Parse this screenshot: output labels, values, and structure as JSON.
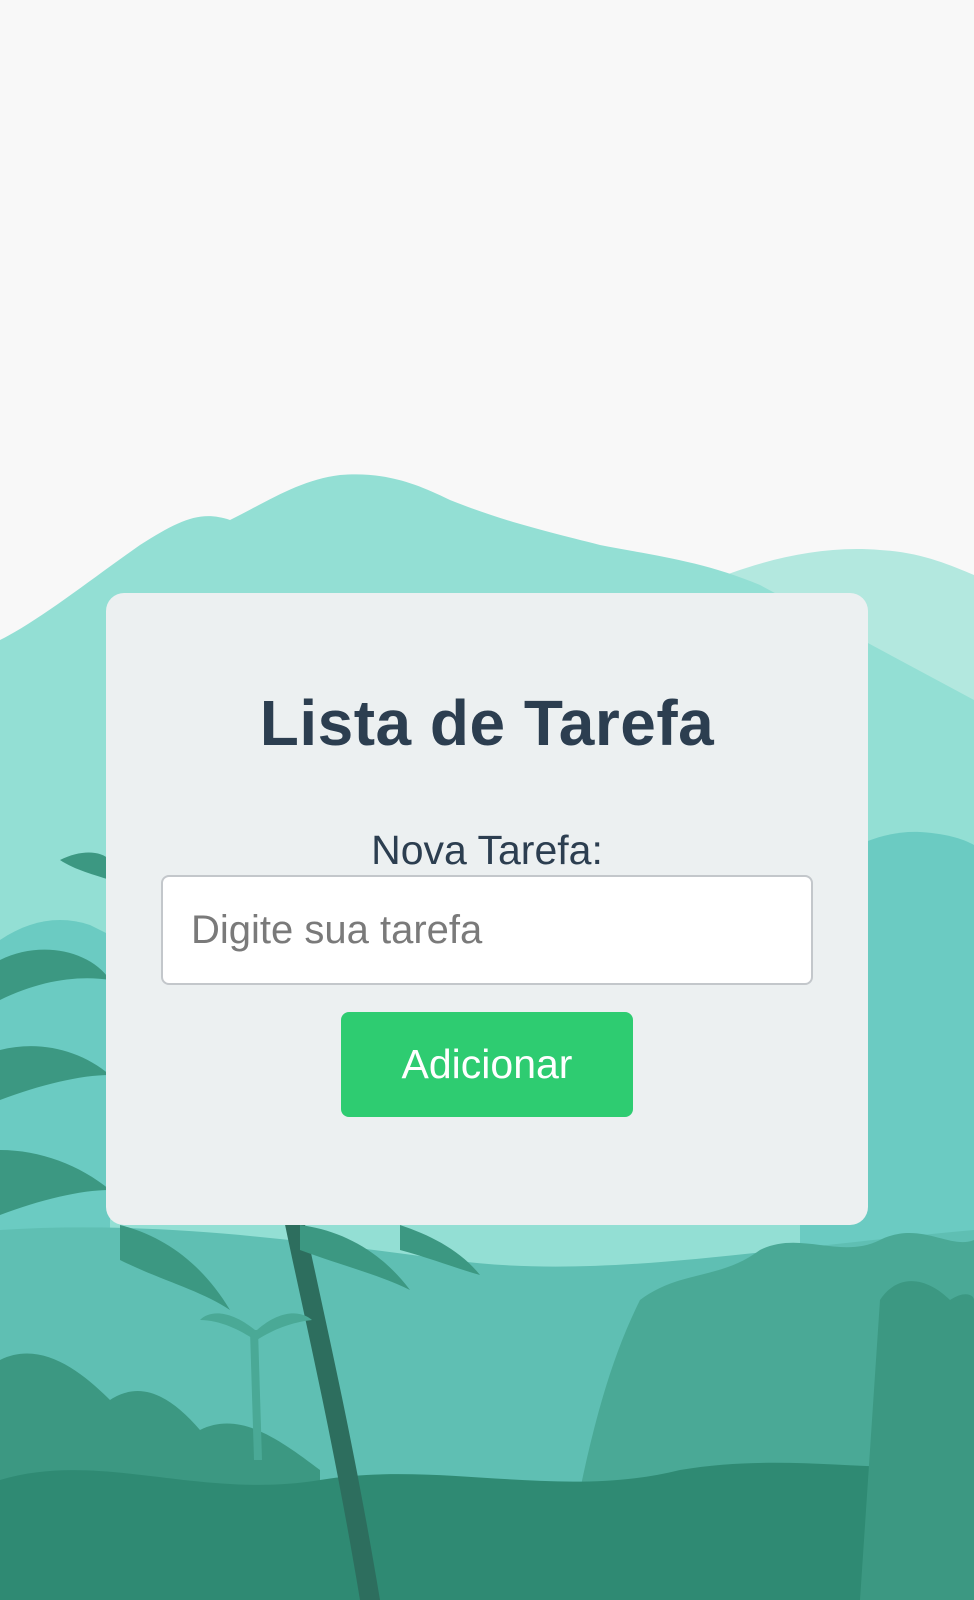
{
  "theme": {
    "background": "#f8f8f8",
    "card_background": "#ecf0f1",
    "text_color": "#2c3e50",
    "button_color": "#2ecc71",
    "button_text_color": "#ffffff",
    "scene_colors": [
      "#b3e8df",
      "#93dfd4",
      "#6bcbc2",
      "#5fbfb3",
      "#4aa996",
      "#3c9882",
      "#2f8a73",
      "#2d6e5e"
    ]
  },
  "card": {
    "title": "Lista de Tarefa",
    "field_label": "Nova Tarefa:",
    "input": {
      "value": "",
      "placeholder": "Digite sua tarefa"
    },
    "add_button_label": "Adicionar"
  }
}
